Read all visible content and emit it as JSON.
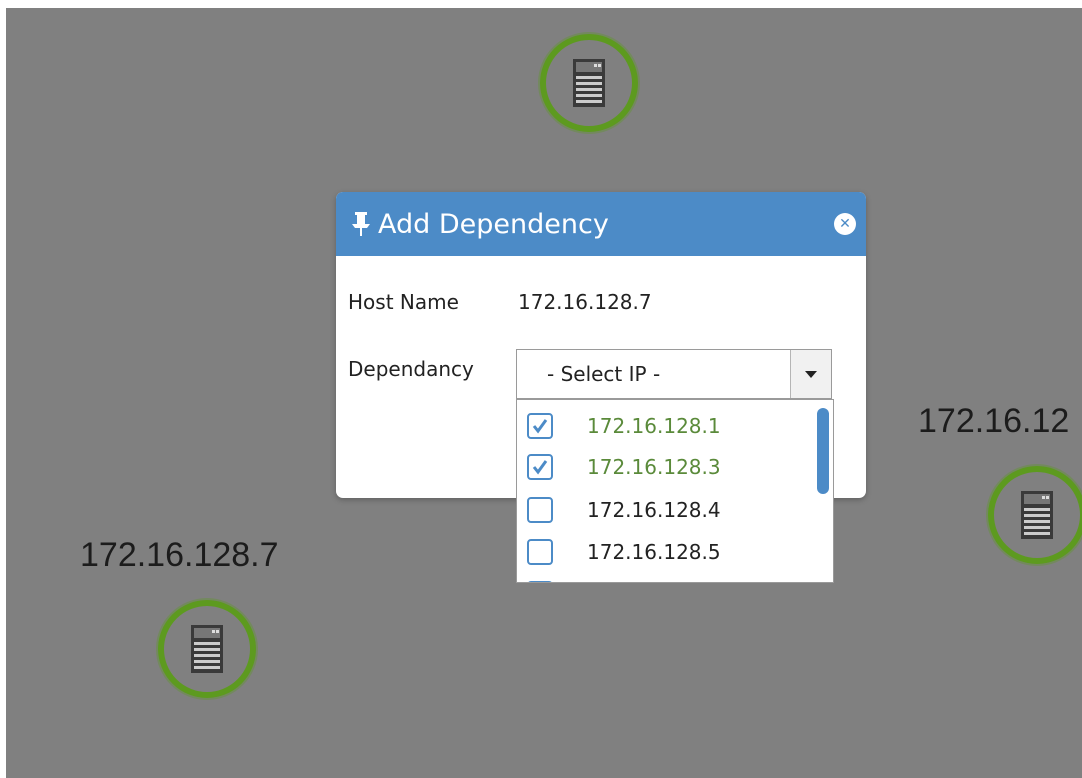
{
  "dialog": {
    "title": "Add Dependency",
    "close_icon": "close-icon",
    "pin_icon": "pin-icon"
  },
  "form": {
    "host_label": "Host Name",
    "host_value": "172.16.128.7",
    "dependency_label": "Dependancy",
    "select_placeholder": "- Select IP -"
  },
  "dropdown": {
    "options": [
      {
        "label": "172.16.128.1",
        "checked": true
      },
      {
        "label": "172.16.128.3",
        "checked": true
      },
      {
        "label": "172.16.128.4",
        "checked": false
      },
      {
        "label": "172.16.128.5",
        "checked": false
      }
    ]
  },
  "nodes": {
    "left_label": "172.16.128.7",
    "right_label": "172.16.12"
  },
  "colors": {
    "header": "#4c8bc7",
    "node_ring": "#5d9a1f",
    "checked_text": "#5a8a3a",
    "canvas": "#808080"
  }
}
